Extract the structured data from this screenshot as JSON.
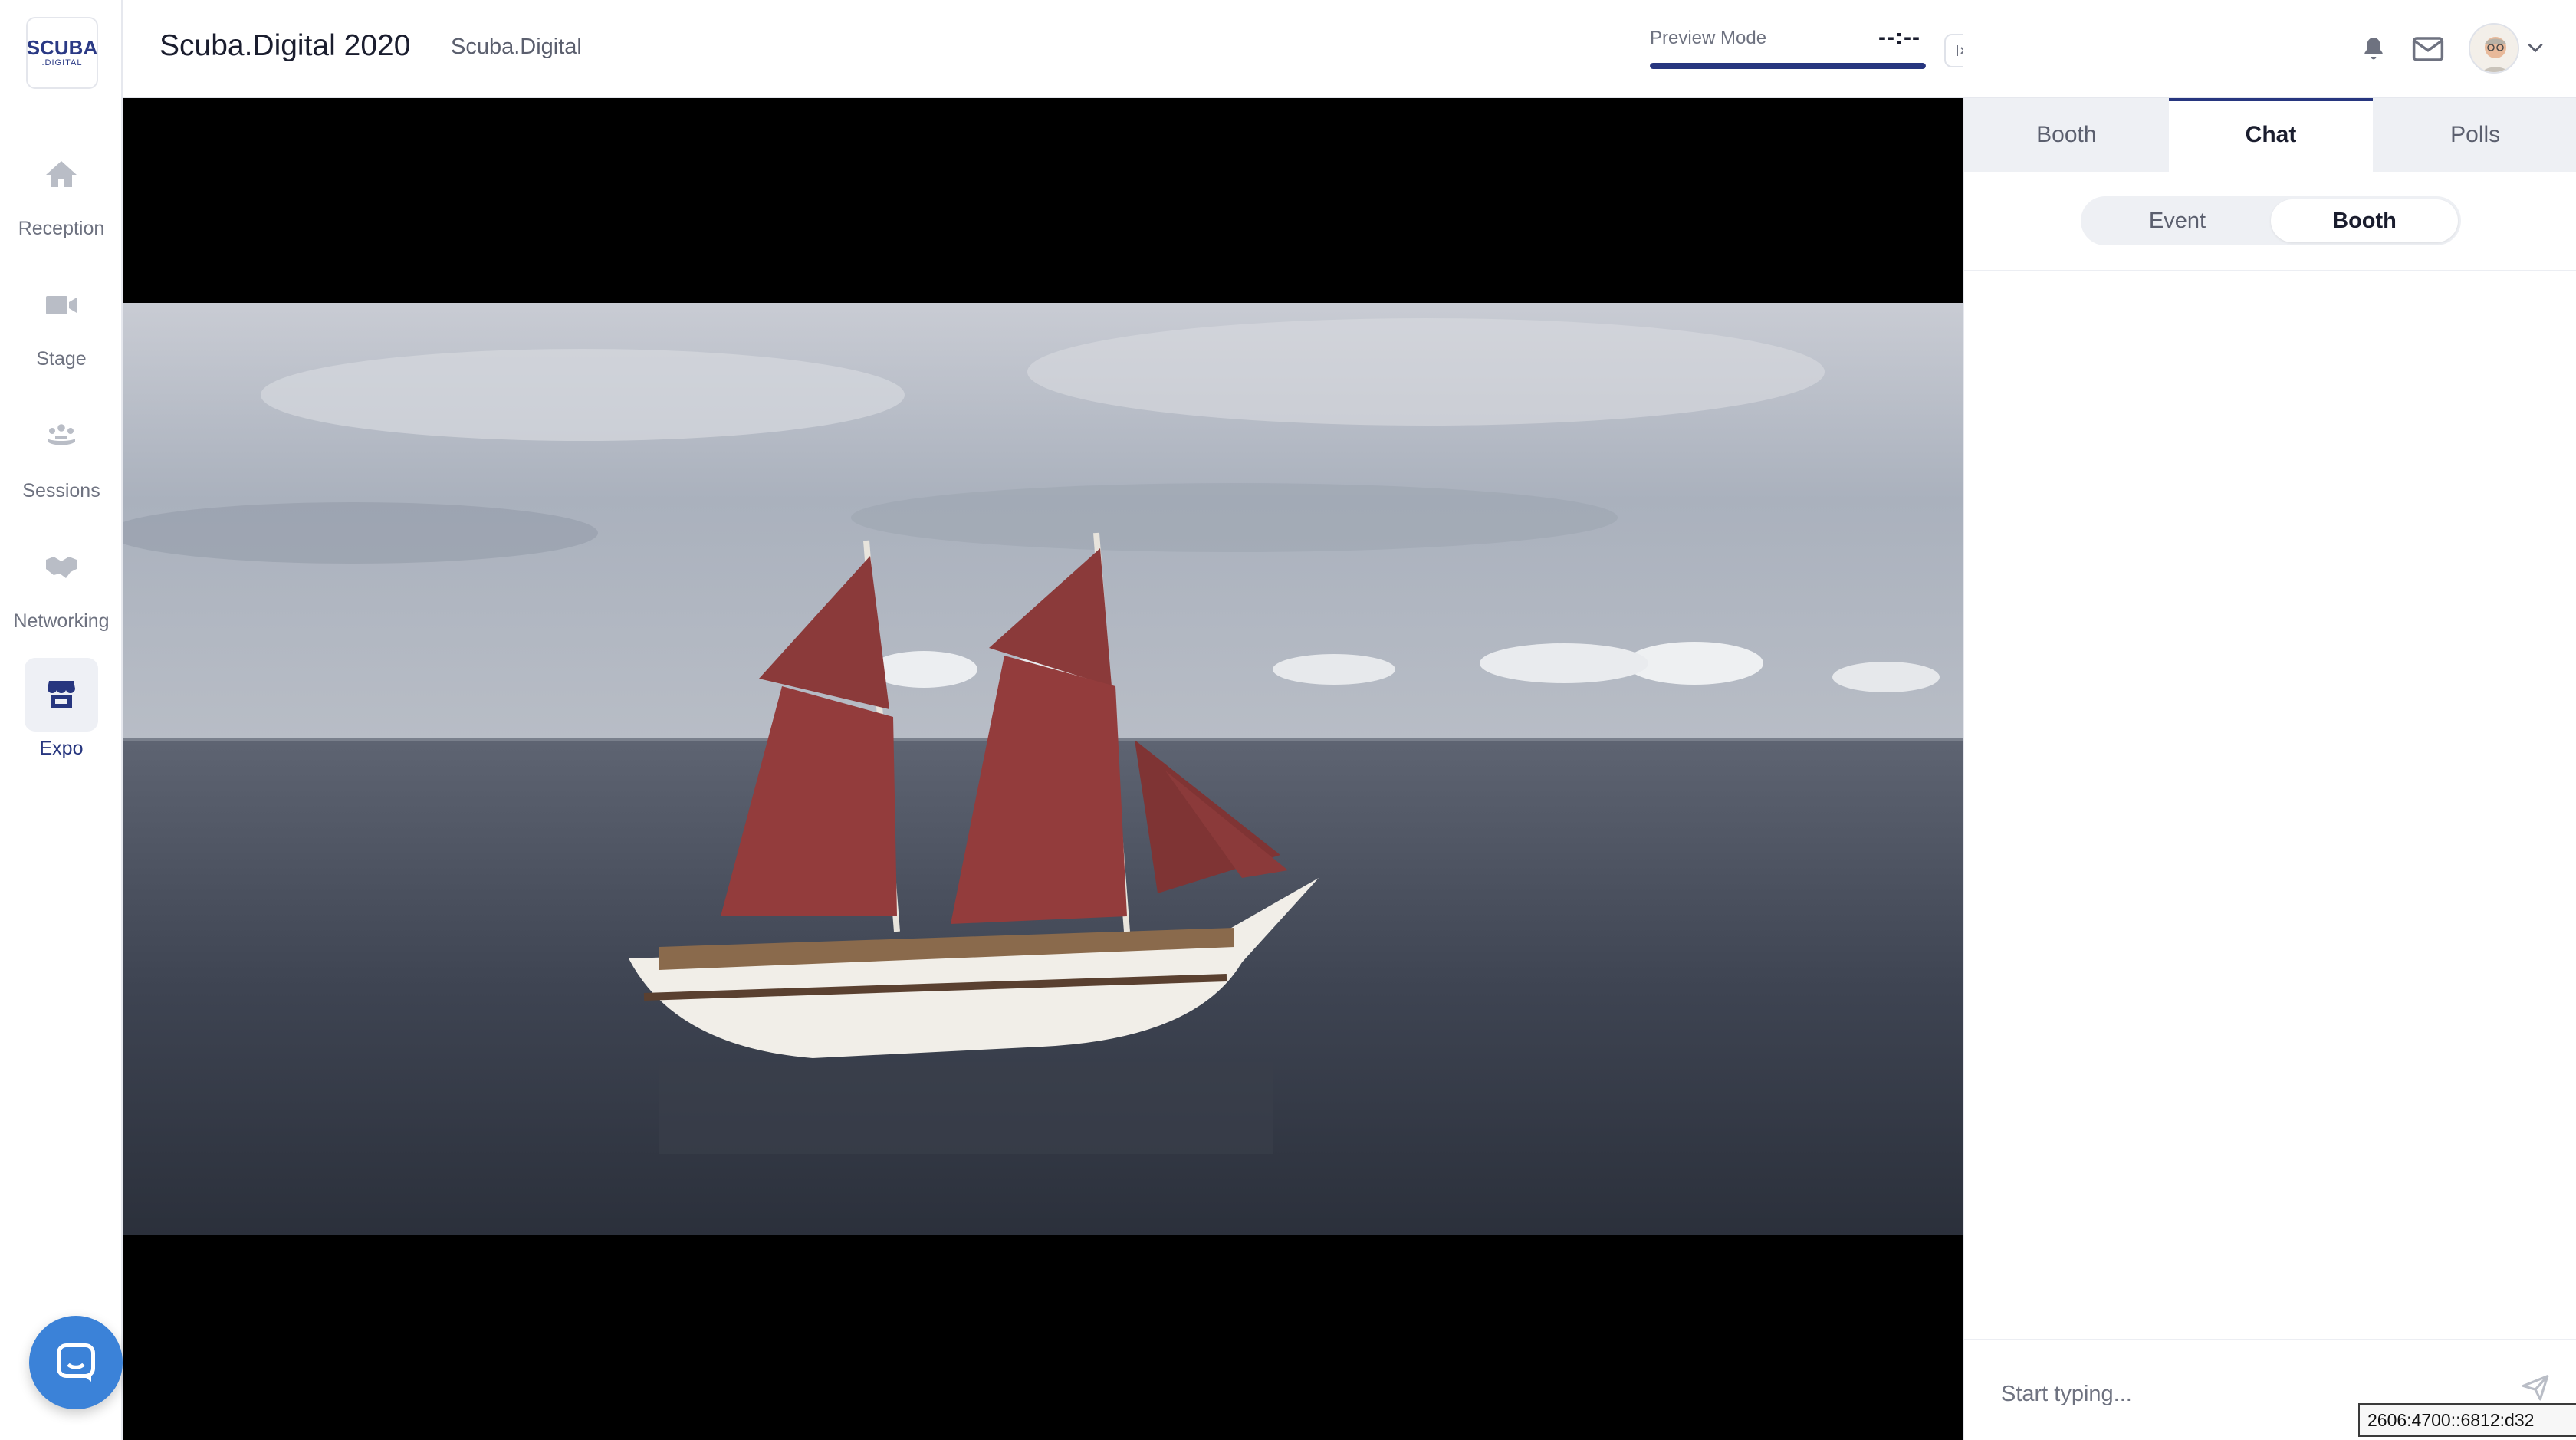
{
  "app": {
    "event_title": "Scuba.Digital 2020",
    "org_name": "Scuba.Digital"
  },
  "logo": {
    "line1": "SCUBA",
    "line2": ".DIGITAL"
  },
  "sidebar": {
    "items": [
      {
        "label": "Reception",
        "icon": "home-icon",
        "active": false
      },
      {
        "label": "Stage",
        "icon": "video-camera-icon",
        "active": false
      },
      {
        "label": "Sessions",
        "icon": "people-group-icon",
        "active": false
      },
      {
        "label": "Networking",
        "icon": "handshake-icon",
        "active": false
      },
      {
        "label": "Expo",
        "icon": "storefront-icon",
        "active": true
      }
    ]
  },
  "header": {
    "preview_label": "Preview Mode",
    "preview_timer": "--:--",
    "preview_progress": 1.0
  },
  "right_panel": {
    "tabs": [
      {
        "label": "Booth",
        "active": false
      },
      {
        "label": "Chat",
        "active": true
      },
      {
        "label": "Polls",
        "active": false
      }
    ],
    "segment": [
      {
        "label": "Event",
        "active": false
      },
      {
        "label": "Booth",
        "active": true
      }
    ],
    "chat_placeholder": "Start typing..."
  },
  "overlay": {
    "ip_text": "2606:4700::6812:d32"
  },
  "colors": {
    "brand": "#27367f",
    "messenger": "#3b82d8",
    "sidebar_icon_inactive": "#b9bdc6"
  }
}
